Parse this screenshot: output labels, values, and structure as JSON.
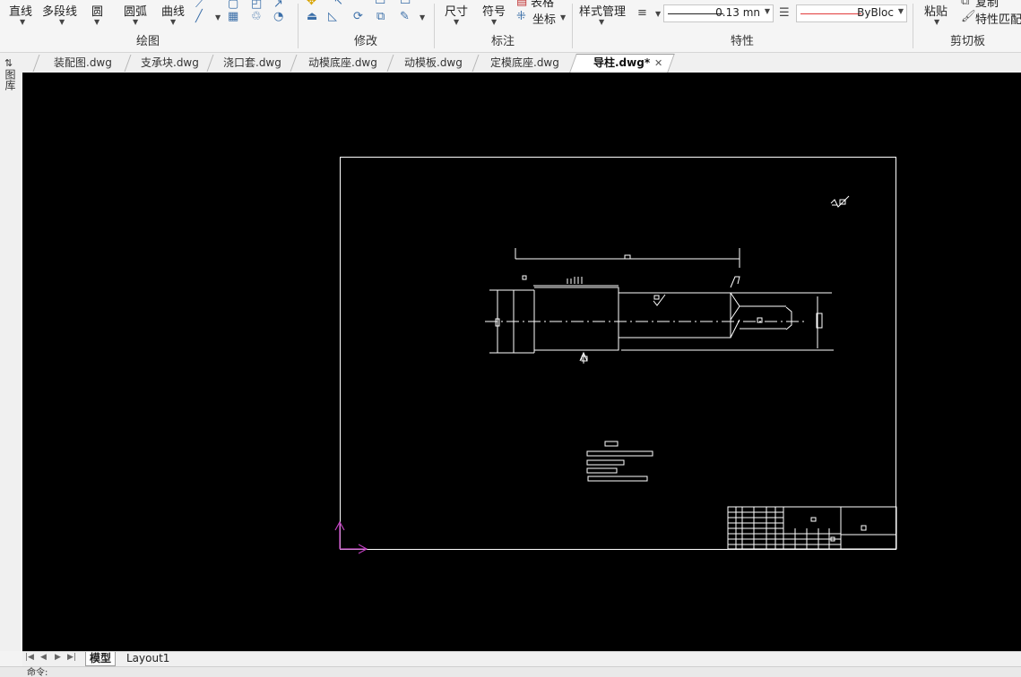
{
  "ribbon": {
    "draw": {
      "title": "绘图",
      "line": "直线",
      "polyline": "多段线",
      "circle": "圆",
      "arc": "圆弧",
      "curve": "曲线"
    },
    "modify": {
      "title": "修改"
    },
    "annotate": {
      "title": "标注",
      "dimension": "尺寸",
      "symbol": "符号",
      "table": "表格",
      "coordinate": "坐标"
    },
    "properties": {
      "title": "特性",
      "style_manager": "样式管理",
      "lineweight": "0.13 mn",
      "color": "ByBloc",
      "color_line": "#e23b3b"
    },
    "clipboard": {
      "title": "剪切板",
      "paste": "粘贴",
      "copy": "复制",
      "match_properties": "特性匹配"
    }
  },
  "side_panel": {
    "label": "图库"
  },
  "tabs": [
    {
      "label": "装配图.dwg"
    },
    {
      "label": "支承块.dwg"
    },
    {
      "label": "浇口套.dwg"
    },
    {
      "label": "动模底座.dwg"
    },
    {
      "label": "动模板.dwg"
    },
    {
      "label": "定模底座.dwg"
    },
    {
      "label": "导柱.dwg*",
      "active": true
    }
  ],
  "layout_tabs": [
    {
      "label": "模型",
      "active": true
    },
    {
      "label": "Layout1"
    }
  ],
  "command_line": "命令:",
  "colors": {
    "canvas_bg": "#000000",
    "drawing_lines": "#ffffff",
    "ucs_icon": "#c040c0",
    "accent": "#3a6ea8"
  }
}
